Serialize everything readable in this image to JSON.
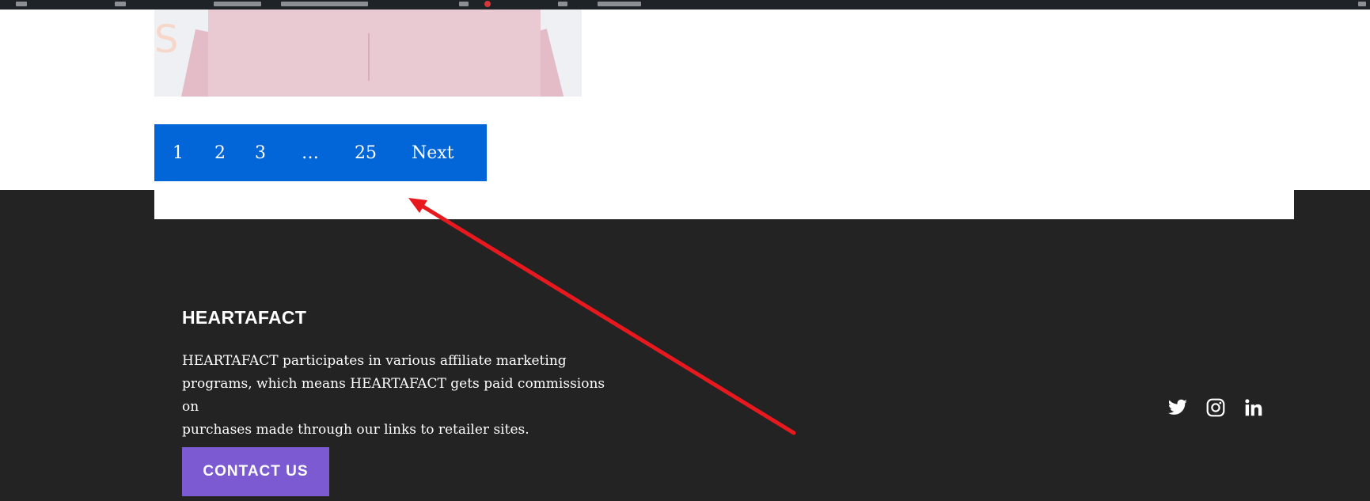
{
  "pagination": {
    "pages": [
      "1",
      "2",
      "3",
      "…",
      "25"
    ],
    "next_label": "Next"
  },
  "footer": {
    "title": "HEARTAFACT",
    "text_lines": [
      "HEARTAFACT participates in various affiliate marketing",
      "programs, which means HEARTAFACT gets paid commissions on",
      "purchases made through our links to retailer sites."
    ],
    "contact_label": "CONTACT US",
    "social_icons": [
      "twitter-icon",
      "instagram-icon",
      "linkedin-icon"
    ]
  },
  "colors": {
    "pagination_bg": "#0265d8",
    "footer_bg": "#232323",
    "contact_button_bg": "#7b5ad2",
    "annotation_arrow": "#e8191e"
  }
}
